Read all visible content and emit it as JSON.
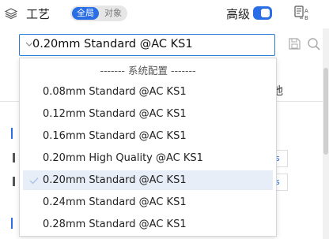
{
  "header": {
    "title": "工艺",
    "scope_tabs": [
      "全局",
      "对象"
    ],
    "advanced_label": "高级",
    "advanced_on": true
  },
  "preset": {
    "value": "0.20mm Standard @AC KS1"
  },
  "background": {
    "tab_partial": "他",
    "stub_a": "s",
    "stub_b": "s"
  },
  "dropdown": {
    "group_header": "------- 系统配置 -------",
    "items": [
      "0.08mm Standard @AC KS1",
      "0.12mm Standard @AC KS1",
      "0.16mm Standard @AC KS1",
      "0.20mm High Quality @AC KS1",
      "0.20mm Standard @AC KS1",
      "0.24mm Standard @AC KS1",
      "0.28mm Standard @AC KS1"
    ],
    "selected_index": 4
  },
  "colors": {
    "accent": "#2a6ee6",
    "focus_border": "#2a7bd8",
    "selected_bg": "#e8eef7"
  }
}
